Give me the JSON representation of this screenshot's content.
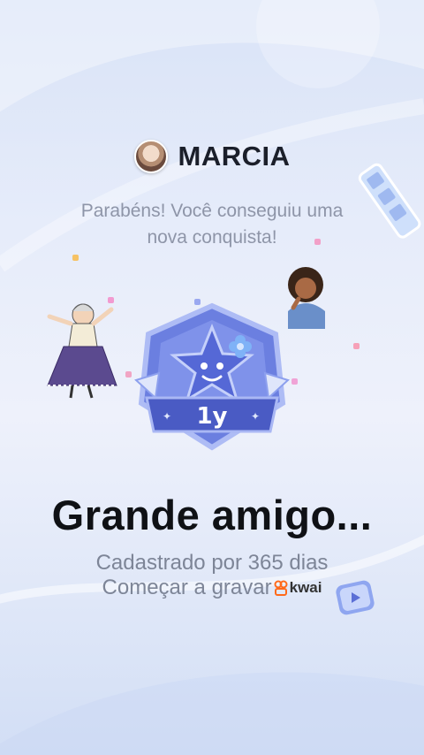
{
  "user": {
    "name": "MARCIA"
  },
  "message": {
    "line1": "Parabéns! Você conseguiu uma",
    "line2": "nova conquista!"
  },
  "badge": {
    "label": "1y"
  },
  "achievement": {
    "title": "Grande amigo...",
    "subtitle": "Cadastrado por 365 dias",
    "cta": "Começar a gravar"
  },
  "brand": {
    "name": "kwai"
  },
  "colors": {
    "badge_primary": "#6b7fe0",
    "badge_dark": "#4a5bc4",
    "accent_orange": "#ff6a1a"
  }
}
